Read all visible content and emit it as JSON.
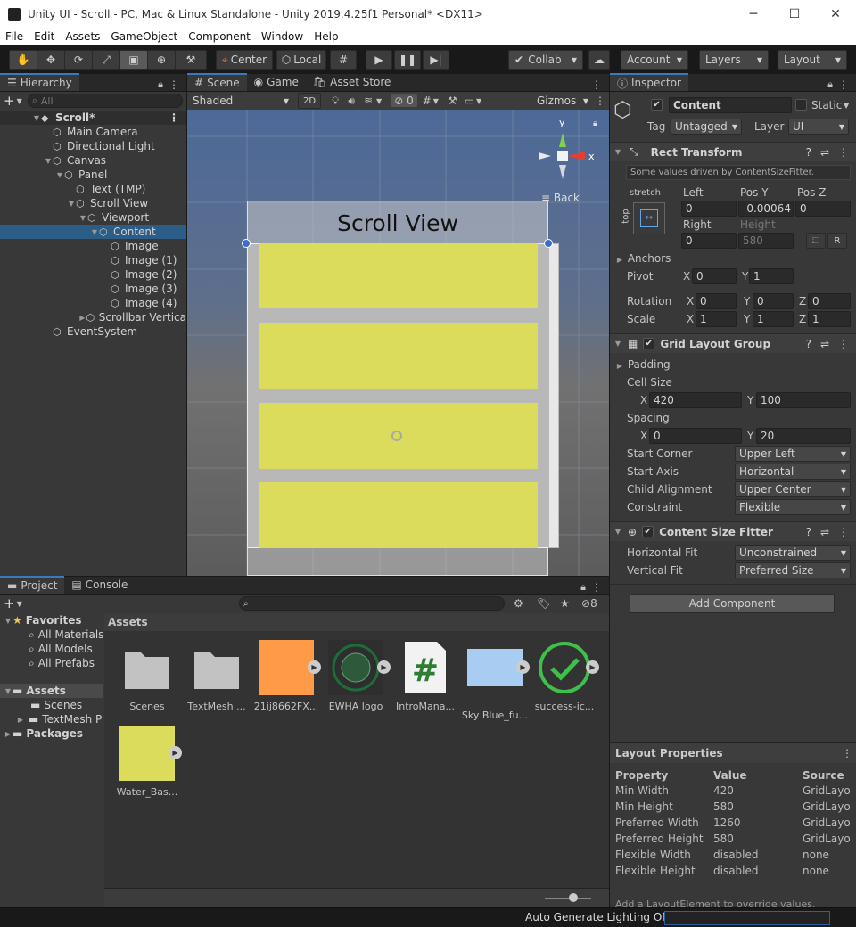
{
  "window": {
    "title": "Unity UI - Scroll - PC, Mac & Linux Standalone - Unity 2019.4.25f1 Personal* <DX11>",
    "min": "─",
    "max": "☐",
    "close": "✕"
  },
  "menu": [
    "File",
    "Edit",
    "Assets",
    "GameObject",
    "Component",
    "Window",
    "Help"
  ],
  "toolbar": {
    "pivot": "Center",
    "space": "Local",
    "collab": "Collab",
    "account": "Account",
    "layers": "Layers",
    "layout": "Layout"
  },
  "hierarchy": {
    "tab": "Hierarchy",
    "search_placeholder": "All",
    "scene": "Scroll*",
    "items": [
      {
        "label": "Main Camera",
        "depth": 1,
        "tri": ""
      },
      {
        "label": "Directional Light",
        "depth": 1,
        "tri": ""
      },
      {
        "label": "Canvas",
        "depth": 1,
        "tri": "▼"
      },
      {
        "label": "Panel",
        "depth": 2,
        "tri": "▼"
      },
      {
        "label": "Text (TMP)",
        "depth": 3,
        "tri": ""
      },
      {
        "label": "Scroll View",
        "depth": 3,
        "tri": "▼"
      },
      {
        "label": "Viewport",
        "depth": 4,
        "tri": "▼"
      },
      {
        "label": "Content",
        "depth": 5,
        "tri": "▼",
        "selected": true
      },
      {
        "label": "Image",
        "depth": 6,
        "tri": ""
      },
      {
        "label": "Image (1)",
        "depth": 6,
        "tri": ""
      },
      {
        "label": "Image (2)",
        "depth": 6,
        "tri": ""
      },
      {
        "label": "Image (3)",
        "depth": 6,
        "tri": ""
      },
      {
        "label": "Image (4)",
        "depth": 6,
        "tri": ""
      },
      {
        "label": "Scrollbar Vertica",
        "depth": 4,
        "tri": "▶"
      },
      {
        "label": "EventSystem",
        "depth": 1,
        "tri": ""
      }
    ]
  },
  "scene": {
    "tabs": [
      "Scene",
      "Game",
      "Asset Store"
    ],
    "shading": "Shaded",
    "mode2d": "2D",
    "hidden_count": "0",
    "gizmos": "Gizmos",
    "scroll_title": "Scroll View",
    "back": "≡ Back",
    "axis_x": "x",
    "axis_y": "y"
  },
  "inspector": {
    "tab": "Inspector",
    "name": "Content",
    "static": "Static",
    "tag_label": "Tag",
    "tag": "Untagged",
    "layer_label": "Layer",
    "layer": "UI",
    "rect": {
      "title": "Rect Transform",
      "note": "Some values driven by ContentSizeFitter.",
      "anchor_h": "stretch",
      "anchor_v": "top",
      "left_label": "Left",
      "left": "0",
      "posy_label": "Pos Y",
      "posy": "-0.00064",
      "posz_label": "Pos Z",
      "posz": "0",
      "right_label": "Right",
      "right": "0",
      "height_label": "Height",
      "height": "580",
      "r": "R",
      "anchors": "Anchors",
      "pivot": "Pivot",
      "pivot_x": "0",
      "pivot_y": "1",
      "rotation": "Rotation",
      "rot_x": "0",
      "rot_y": "0",
      "rot_z": "0",
      "scale": "Scale",
      "scale_x": "1",
      "scale_y": "1",
      "scale_z": "1",
      "X": "X",
      "Y": "Y",
      "Z": "Z"
    },
    "grid": {
      "title": "Grid Layout Group",
      "padding": "Padding",
      "cell_size": "Cell Size",
      "cell_x": "420",
      "cell_y": "100",
      "spacing": "Spacing",
      "sp_x": "0",
      "sp_y": "20",
      "start_corner_label": "Start Corner",
      "start_corner": "Upper Left",
      "start_axis_label": "Start Axis",
      "start_axis": "Horizontal",
      "child_align_label": "Child Alignment",
      "child_align": "Upper Center",
      "constraint_label": "Constraint",
      "constraint": "Flexible"
    },
    "fitter": {
      "title": "Content Size Fitter",
      "hfit_label": "Horizontal Fit",
      "hfit": "Unconstrained",
      "vfit_label": "Vertical Fit",
      "vfit": "Preferred Size"
    },
    "add_component": "Add Component",
    "layout_props": {
      "title": "Layout Properties",
      "headers": [
        "Property",
        "Value",
        "Source"
      ],
      "rows": [
        [
          "Min Width",
          "420",
          "GridLayo"
        ],
        [
          "Min Height",
          "580",
          "GridLayo"
        ],
        [
          "Preferred Width",
          "1260",
          "GridLayo"
        ],
        [
          "Preferred Height",
          "580",
          "GridLayo"
        ],
        [
          "Flexible Width",
          "disabled",
          "none"
        ],
        [
          "Flexible Height",
          "disabled",
          "none"
        ]
      ],
      "footer": "Add a LayoutElement to override values."
    }
  },
  "project": {
    "tabs": [
      "Project",
      "Console"
    ],
    "hidden_count": "8",
    "breadcrumb": "Assets",
    "favorites": "Favorites",
    "fav_items": [
      "All Materials",
      "All Models",
      "All Prefabs"
    ],
    "assets": "Assets",
    "asset_children": [
      "Scenes",
      "TextMesh P"
    ],
    "packages": "Packages",
    "grid": [
      {
        "label": "Scenes",
        "kind": "folder"
      },
      {
        "label": "TextMesh ...",
        "kind": "folder"
      },
      {
        "label": "21ij8662FX...",
        "kind": "orange"
      },
      {
        "label": "EWHA logo",
        "kind": "logo"
      },
      {
        "label": "IntroMana...",
        "kind": "script"
      },
      {
        "label": "Sky Blue_fu...",
        "kind": "sky"
      },
      {
        "label": "success-ic...",
        "kind": "check"
      },
      {
        "label": "Water_Bas...",
        "kind": "yellow"
      }
    ]
  },
  "status": {
    "text": "Auto Generate Lighting Off"
  },
  "colors": {
    "accent": "#3a79bb",
    "yellow": "#dcdc5c",
    "orange": "#ff9a46",
    "sky": "#a9cdf2",
    "green": "#3ec04a",
    "scene_bg": "#5470a0"
  }
}
